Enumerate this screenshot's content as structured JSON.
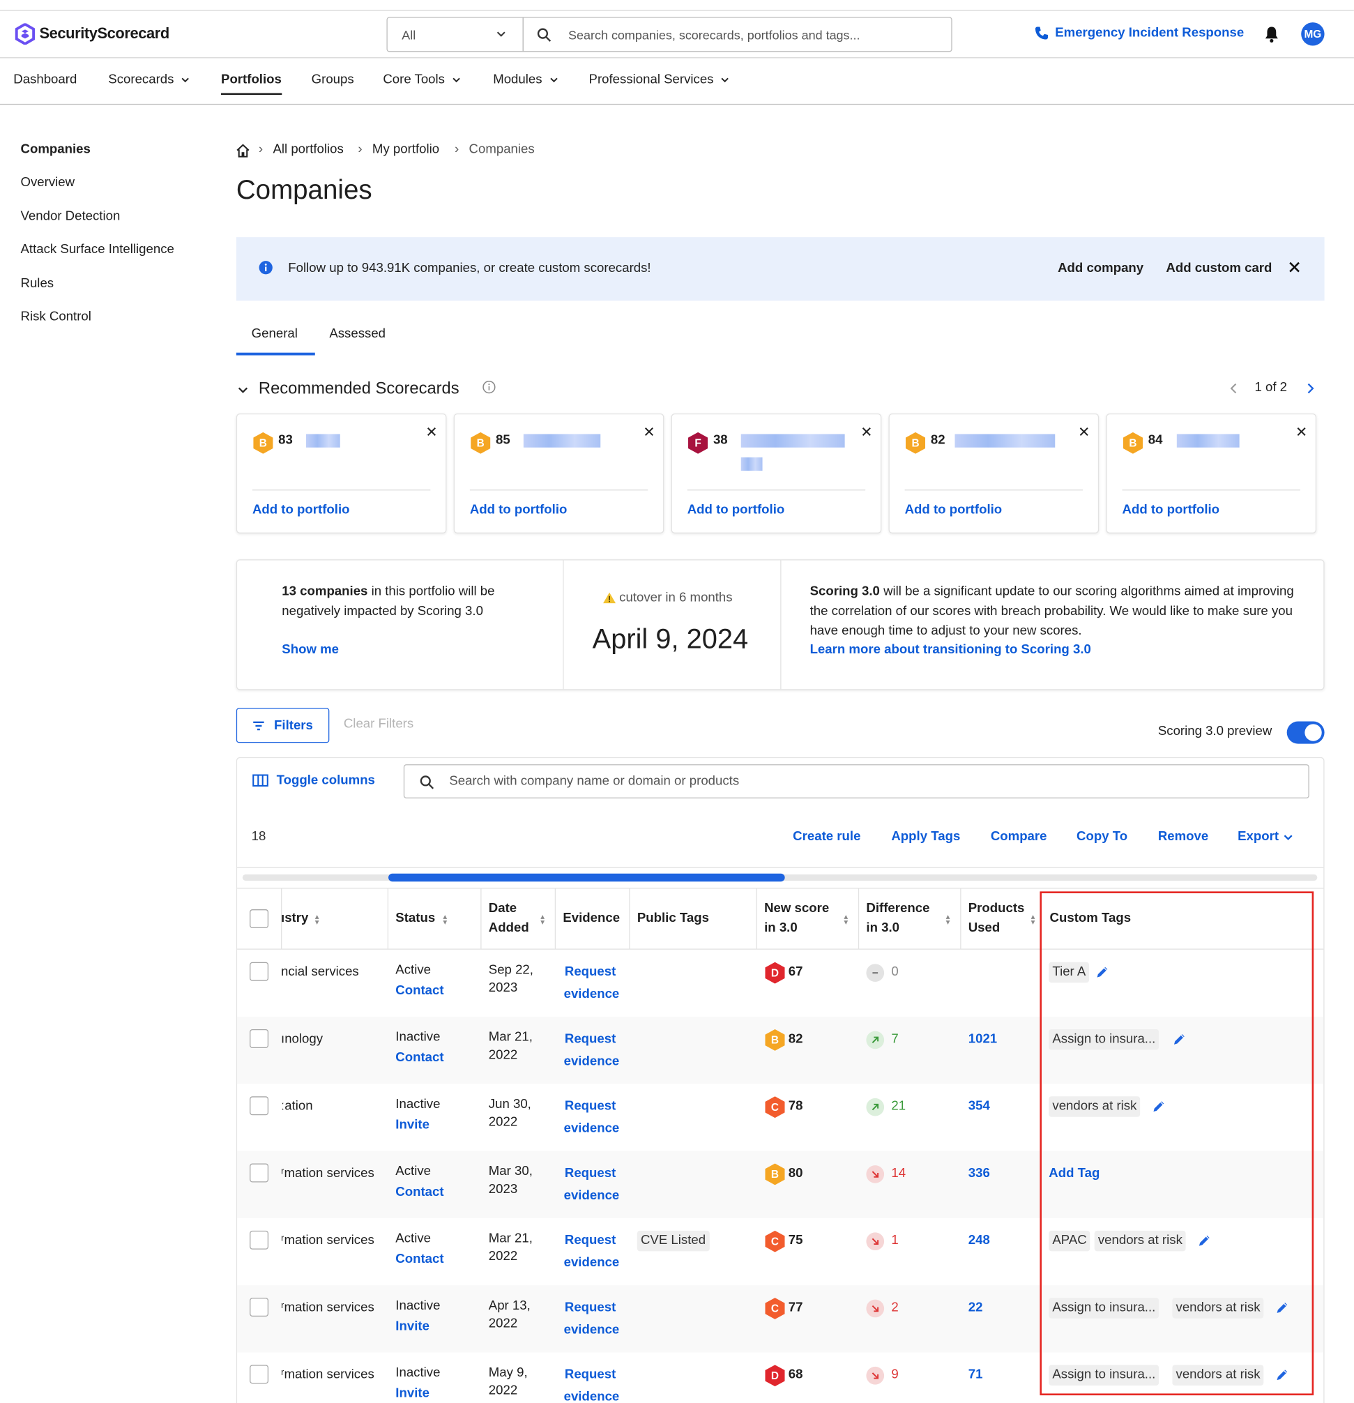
{
  "header": {
    "brand": "SecurityScorecard",
    "scope_value": "All",
    "search_placeholder": "Search companies, scorecards, portfolios and tags...",
    "emergency_label": "Emergency Incident Response",
    "avatar_initials": "MG"
  },
  "nav": {
    "items": [
      "Dashboard",
      "Scorecards",
      "Portfolios",
      "Groups",
      "Core Tools",
      "Modules",
      "Professional Services"
    ],
    "active": "Portfolios"
  },
  "sidebar": {
    "items": [
      "Companies",
      "Overview",
      "Vendor Detection",
      "Attack Surface Intelligence",
      "Rules",
      "Risk Control"
    ]
  },
  "breadcrumb": [
    "All portfolios",
    "My portfolio",
    "Companies"
  ],
  "page_title": "Companies",
  "banner": {
    "message": "Follow up to 943.91K companies, or create custom scorecards!",
    "add_company": "Add company",
    "add_custom_card": "Add custom card"
  },
  "tabs": [
    "General",
    "Assessed"
  ],
  "recommended": {
    "title": "Recommended Scorecards",
    "pager": "1 of 2",
    "add_label": "Add to portfolio",
    "cards": [
      {
        "grade": "B",
        "score": "83"
      },
      {
        "grade": "B",
        "score": "85"
      },
      {
        "grade": "F",
        "score": "38"
      },
      {
        "grade": "B",
        "score": "82"
      },
      {
        "grade": "B",
        "score": "84"
      }
    ]
  },
  "scoring": {
    "impact_bold": "13 companies",
    "impact_rest": " in this portfolio will be negatively impacted by Scoring 3.0",
    "show_me": "Show me",
    "cutover": "cutover in 6 months",
    "date": "April 9, 2024",
    "info_bold": "Scoring 3.0",
    "info_rest": " will be a significant update to our scoring algorithms aimed at improving the correlation of our scores with breach probability. We would like to make sure you have enough time to adjust to your new scores.",
    "learn_more": "Learn more about transitioning to Scoring 3.0"
  },
  "filters": {
    "filters_label": "Filters",
    "clear_label": "Clear Filters",
    "preview_label": "Scoring 3.0 preview"
  },
  "table": {
    "toggle_columns": "Toggle columns",
    "search_placeholder": "Search with company name or domain or products",
    "count": "18",
    "actions": [
      "Create rule",
      "Apply Tags",
      "Compare",
      "Copy To",
      "Remove",
      "Export"
    ],
    "headers": {
      "industry": "ıstry",
      "status": "Status",
      "date_1": "Date",
      "date_2": "Added",
      "evidence": "Evidence",
      "public_tags": "Public Tags",
      "new_score_1": "New score",
      "new_score_2": "in 3.0",
      "diff_1": "Difference",
      "diff_2": "in 3.0",
      "products_1": "Products",
      "products_2": "Used",
      "custom_tags": "Custom Tags"
    },
    "evidence_1": "Request",
    "evidence_2": "evidence",
    "add_tag": "Add Tag",
    "rows": [
      {
        "industry": "ncial services",
        "status": "Active",
        "action": "Contact",
        "date1": "Sep 22,",
        "date2": "2023",
        "public_tag": "",
        "grade": "D",
        "score": "67",
        "diff_dir": "zero",
        "diff": "0",
        "products": "",
        "tags": [
          "Tier A"
        ]
      },
      {
        "industry": "ınology",
        "status": "Inactive",
        "action": "Contact",
        "date1": "Mar 21,",
        "date2": "2022",
        "public_tag": "",
        "grade": "B",
        "score": "82",
        "diff_dir": "up",
        "diff": "7",
        "products": "1021",
        "tags": [
          "Assign to insura..."
        ]
      },
      {
        "industry": "ːation",
        "status": "Inactive",
        "action": "Invite",
        "date1": "Jun 30,",
        "date2": "2022",
        "public_tag": "",
        "grade": "C",
        "score": "78",
        "diff_dir": "up",
        "diff": "21",
        "products": "354",
        "tags": [
          "vendors at risk"
        ]
      },
      {
        "industry": "ʳmation services",
        "status": "Active",
        "action": "Contact",
        "date1": "Mar 30,",
        "date2": "2023",
        "public_tag": "",
        "grade": "B",
        "score": "80",
        "diff_dir": "down",
        "diff": "14",
        "products": "336",
        "tags": []
      },
      {
        "industry": "ʳmation services",
        "status": "Active",
        "action": "Contact",
        "date1": "Mar 21,",
        "date2": "2022",
        "public_tag": "CVE Listed",
        "grade": "C",
        "score": "75",
        "diff_dir": "down",
        "diff": "1",
        "products": "248",
        "tags": [
          "APAC",
          "vendors at risk"
        ]
      },
      {
        "industry": "ʳmation services",
        "status": "Inactive",
        "action": "Invite",
        "date1": "Apr 13,",
        "date2": "2022",
        "public_tag": "",
        "grade": "C",
        "score": "77",
        "diff_dir": "down",
        "diff": "2",
        "products": "22",
        "tags": [
          "Assign to insura...",
          "vendors at risk"
        ]
      },
      {
        "industry": "ʳmation services",
        "status": "Inactive",
        "action": "Invite",
        "date1": "May 9,",
        "date2": "2022",
        "public_tag": "",
        "grade": "D",
        "score": "68",
        "diff_dir": "down",
        "diff": "9",
        "products": "71",
        "tags": [
          "Assign to insura...",
          "vendors at risk"
        ]
      }
    ]
  },
  "colors": {
    "accent": "#1e64e0",
    "link": "#0d5bd7",
    "grade_B": "#f5a623",
    "grade_C": "#f25c2d",
    "grade_D": "#e0262d",
    "grade_F": "#a8123e",
    "highlight": "#e52420"
  }
}
